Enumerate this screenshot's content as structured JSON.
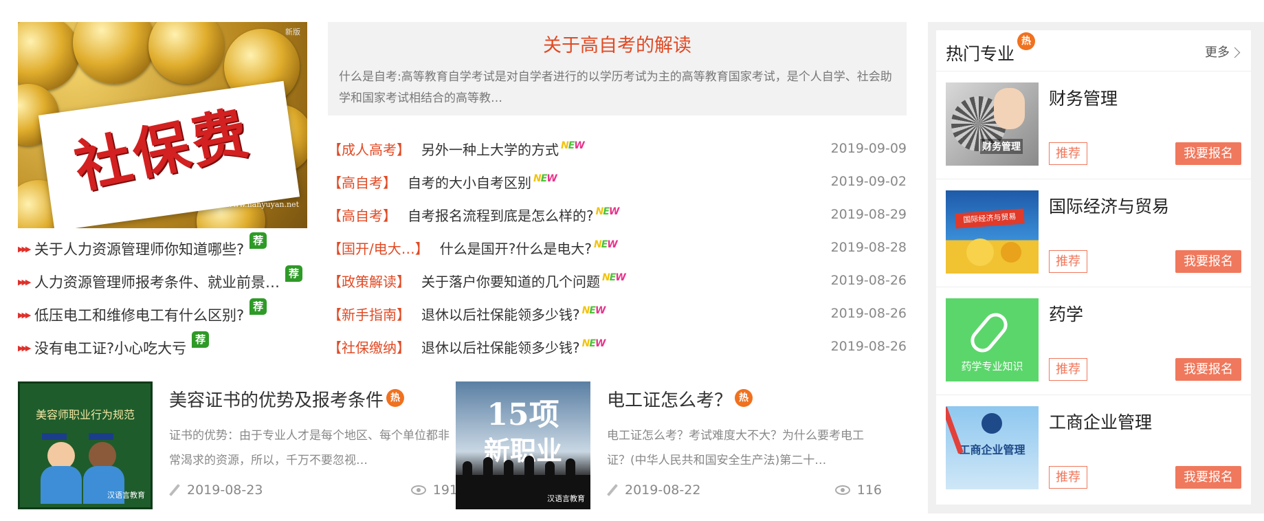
{
  "featured": {
    "image_text": "社保费",
    "watermark": "www.hanyuyan.net",
    "watermark_tag": "新版"
  },
  "left_list": [
    {
      "text": "关于人力资源管理师你知道哪些?",
      "badge": "荐"
    },
    {
      "text": "人力资源管理师报考条件、就业前景…",
      "badge": "荐"
    },
    {
      "text": "低压电工和维修电工有什么区别?",
      "badge": "荐"
    },
    {
      "text": "没有电工证?小心吃大亏",
      "badge": "荐"
    }
  ],
  "intro": {
    "title": "关于高自考的解读",
    "text": "什么是自考:高等教育自学考试是对自学者进行的以学历考试为主的高等教育国家考试，是个人自学、社会助学和国家考试相结合的高等教…"
  },
  "news": [
    {
      "category": "【成人高考】",
      "title": "另外一种上大学的方式",
      "date": "2019-09-09"
    },
    {
      "category": "【高自考】",
      "title": "自考的大小自考区别",
      "date": "2019-09-02"
    },
    {
      "category": "【高自考】",
      "title": "自考报名流程到底是怎么样的?",
      "date": "2019-08-29"
    },
    {
      "category": "【国开/电大…】",
      "title": "什么是国开?什么是电大?",
      "date": "2019-08-28"
    },
    {
      "category": "【政策解读】",
      "title": "关于落户你要知道的几个问题",
      "date": "2019-08-26"
    },
    {
      "category": "【新手指南】",
      "title": "退休以后社保能领多少钱?",
      "date": "2019-08-26"
    },
    {
      "category": "【社保缴纳】",
      "title": "退休以后社保能领多少钱?",
      "date": "2019-08-26"
    }
  ],
  "new_badge": [
    "N",
    "E",
    "W"
  ],
  "cards": [
    {
      "image_text": "美容师职业行为规范",
      "image_caption": "汉语言教育",
      "title": "美容证书的优势及报考条件",
      "hot": "热",
      "desc": "证书的优势：由于专业人才是每个地区、每个单位都非常渴求的资源，所以，千万不要忽视…",
      "date": "2019-08-23",
      "views": "191"
    },
    {
      "image_text": "15项",
      "image_text2": "新职业",
      "image_caption": "汉语言教育",
      "title": "电工证怎么考？",
      "hot": "热",
      "desc": "电工证怎么考？考试难度大不大？为什么要考电工证？(中华人民共和国安全生产法)第二十…",
      "date": "2019-08-22",
      "views": "116"
    }
  ],
  "sidebar": {
    "title": "热门专业",
    "hot": "热",
    "more": "更多",
    "recommend_label": "推荐",
    "register_label": "我要报名",
    "programs": [
      {
        "name": "财务管理",
        "thumb_text": "财务管理"
      },
      {
        "name": "国际经济与贸易",
        "thumb_text": "国际经济与贸易"
      },
      {
        "name": "药学",
        "thumb_text": "药学专业知识"
      },
      {
        "name": "工商企业管理",
        "thumb_text": "工商企业管理"
      }
    ]
  }
}
